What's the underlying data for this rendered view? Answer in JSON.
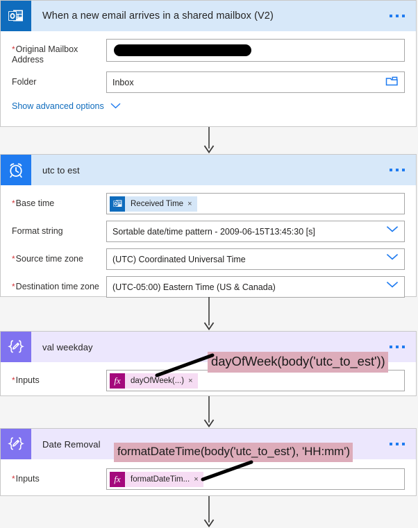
{
  "flow": {
    "cards": [
      {
        "id": "trigger-email",
        "title": "When a new email arrives in a shared mailbox (V2)",
        "icon": "outlook-icon",
        "theme": "blue",
        "fields": [
          {
            "label": "Original Mailbox Address",
            "required": true,
            "value": "",
            "redacted": true,
            "control": "text"
          },
          {
            "label": "Folder",
            "required": false,
            "value": "Inbox",
            "control": "folder-picker"
          }
        ],
        "advanced_label": "Show advanced options"
      },
      {
        "id": "utc-to-est",
        "title": "utc to est",
        "icon": "alarm-clock-icon",
        "theme": "blue",
        "fields": [
          {
            "label": "Base time",
            "required": true,
            "control": "token",
            "token": {
              "type": "data",
              "icon": "outlook-icon",
              "text": "Received Time",
              "remove": "×"
            }
          },
          {
            "label": "Format string",
            "required": false,
            "control": "dropdown",
            "value": "Sortable date/time pattern - 2009-06-15T13:45:30 [s]"
          },
          {
            "label": "Source time zone",
            "required": true,
            "control": "dropdown",
            "value": "(UTC) Coordinated Universal Time"
          },
          {
            "label": "Destination time zone",
            "required": true,
            "control": "dropdown",
            "value": "(UTC-05:00) Eastern Time (US & Canada)"
          }
        ]
      },
      {
        "id": "val-weekday",
        "title": "val weekday",
        "icon": "compose-icon",
        "theme": "purple",
        "fields": [
          {
            "label": "Inputs",
            "required": true,
            "control": "token",
            "token": {
              "type": "expression",
              "icon": "fx-icon",
              "text": "dayOfWeek(...)",
              "remove": "×"
            }
          }
        ]
      },
      {
        "id": "date-removal",
        "title": "Date Removal",
        "icon": "compose-icon",
        "theme": "purple",
        "fields": [
          {
            "label": "Inputs",
            "required": true,
            "control": "token",
            "token": {
              "type": "expression",
              "icon": "fx-icon",
              "text": "formatDateTim...",
              "remove": "×"
            }
          }
        ]
      }
    ],
    "annotations": [
      {
        "id": "annotation-dayofweek",
        "text": "dayOfWeek(body('utc_to_est'))"
      },
      {
        "id": "annotation-formatdatetime",
        "text": "formatDateTime(body('utc_to_est'), 'HH:mm')"
      }
    ],
    "menu_label": "…"
  },
  "colors": {
    "header_blue": "#d7e8f9",
    "header_purple": "#ece7fd",
    "icon_blue": "#1f7bf0",
    "icon_outlook": "#0f6cbd",
    "icon_purple": "#8073f0",
    "accent_link": "#0f6cbd",
    "required_red": "#d13438",
    "annotation_highlight": "#ddacba",
    "expression_magenta": "#a4097c",
    "canvas": "#f5f5f5"
  }
}
